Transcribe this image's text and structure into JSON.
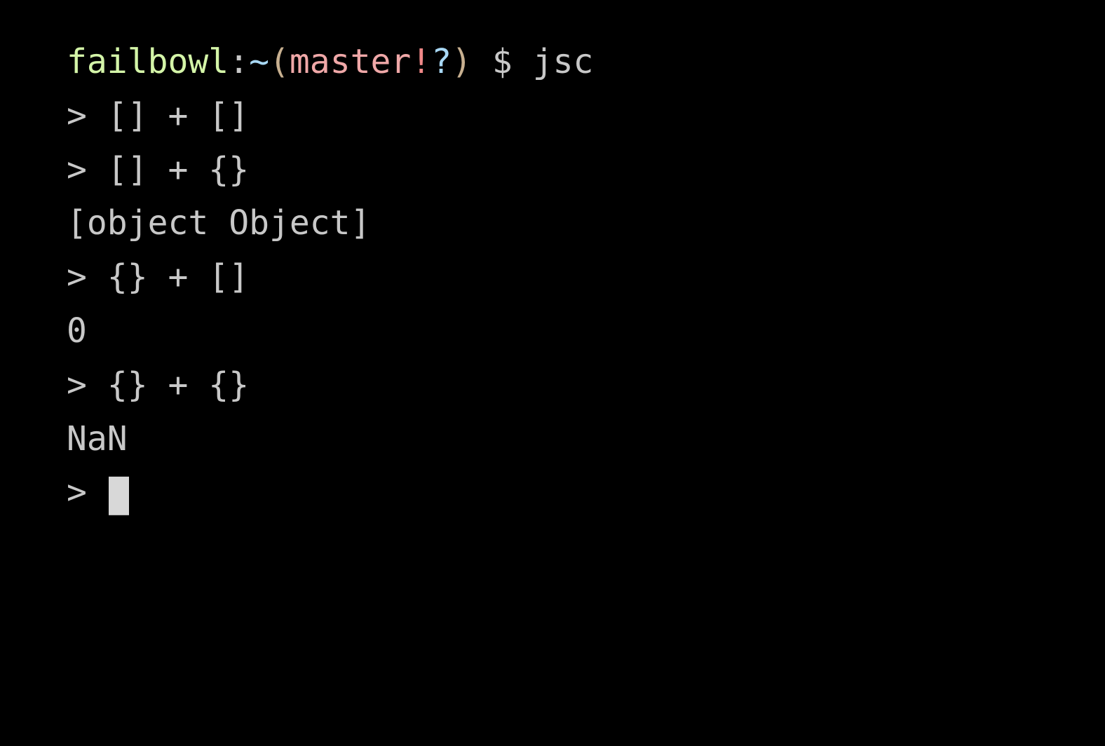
{
  "shell_prompt": {
    "host": "failbowl",
    "colon": ":",
    "tilde": "~",
    "paren_open": "(",
    "branch": "master",
    "bang": "!",
    "question": "?",
    "paren_close": ")",
    "dollar": " $ ",
    "command": "jsc"
  },
  "repl": {
    "prompt": ">",
    "entries": [
      {
        "input": "[] + []",
        "output": ""
      },
      {
        "input": "[] + {}",
        "output": "[object Object]"
      },
      {
        "input": "{} + []",
        "output": "0"
      },
      {
        "input": "{} + {}",
        "output": "NaN"
      }
    ]
  }
}
